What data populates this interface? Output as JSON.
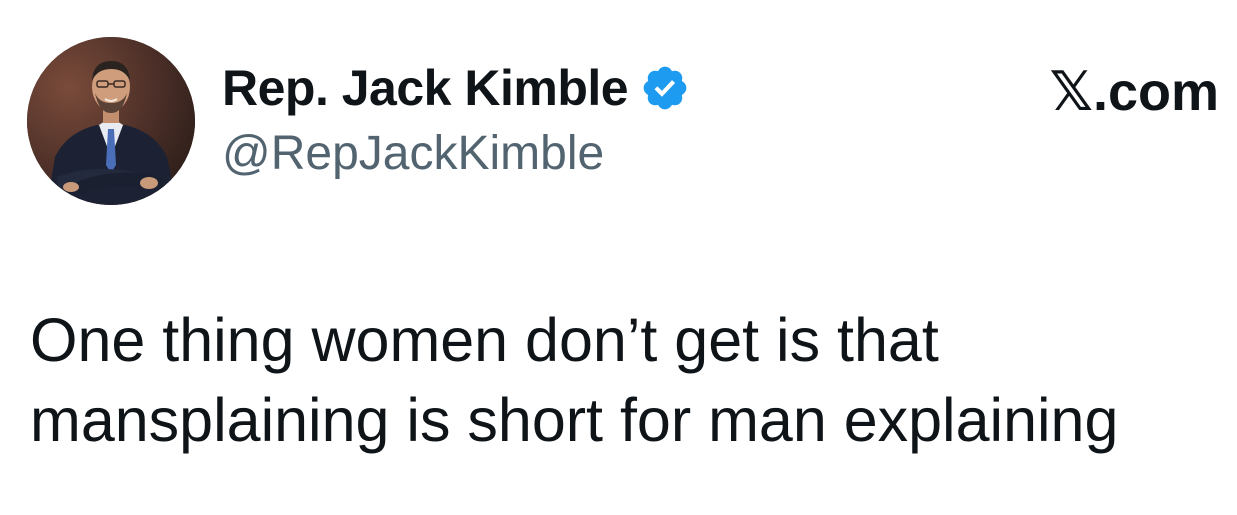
{
  "author": {
    "display_name": "Rep. Jack Kimble",
    "handle": "@RepJackKimble",
    "verified": true,
    "avatar_icon": "profile-photo",
    "verified_color": "#1d9bf0"
  },
  "brand": {
    "label": "𝕏.com"
  },
  "tweet": {
    "text": "One thing women don’t get is that\nmansplaining is short for man explaining"
  },
  "colors": {
    "text": "#0f1419",
    "secondary": "#536471",
    "background": "#ffffff"
  }
}
